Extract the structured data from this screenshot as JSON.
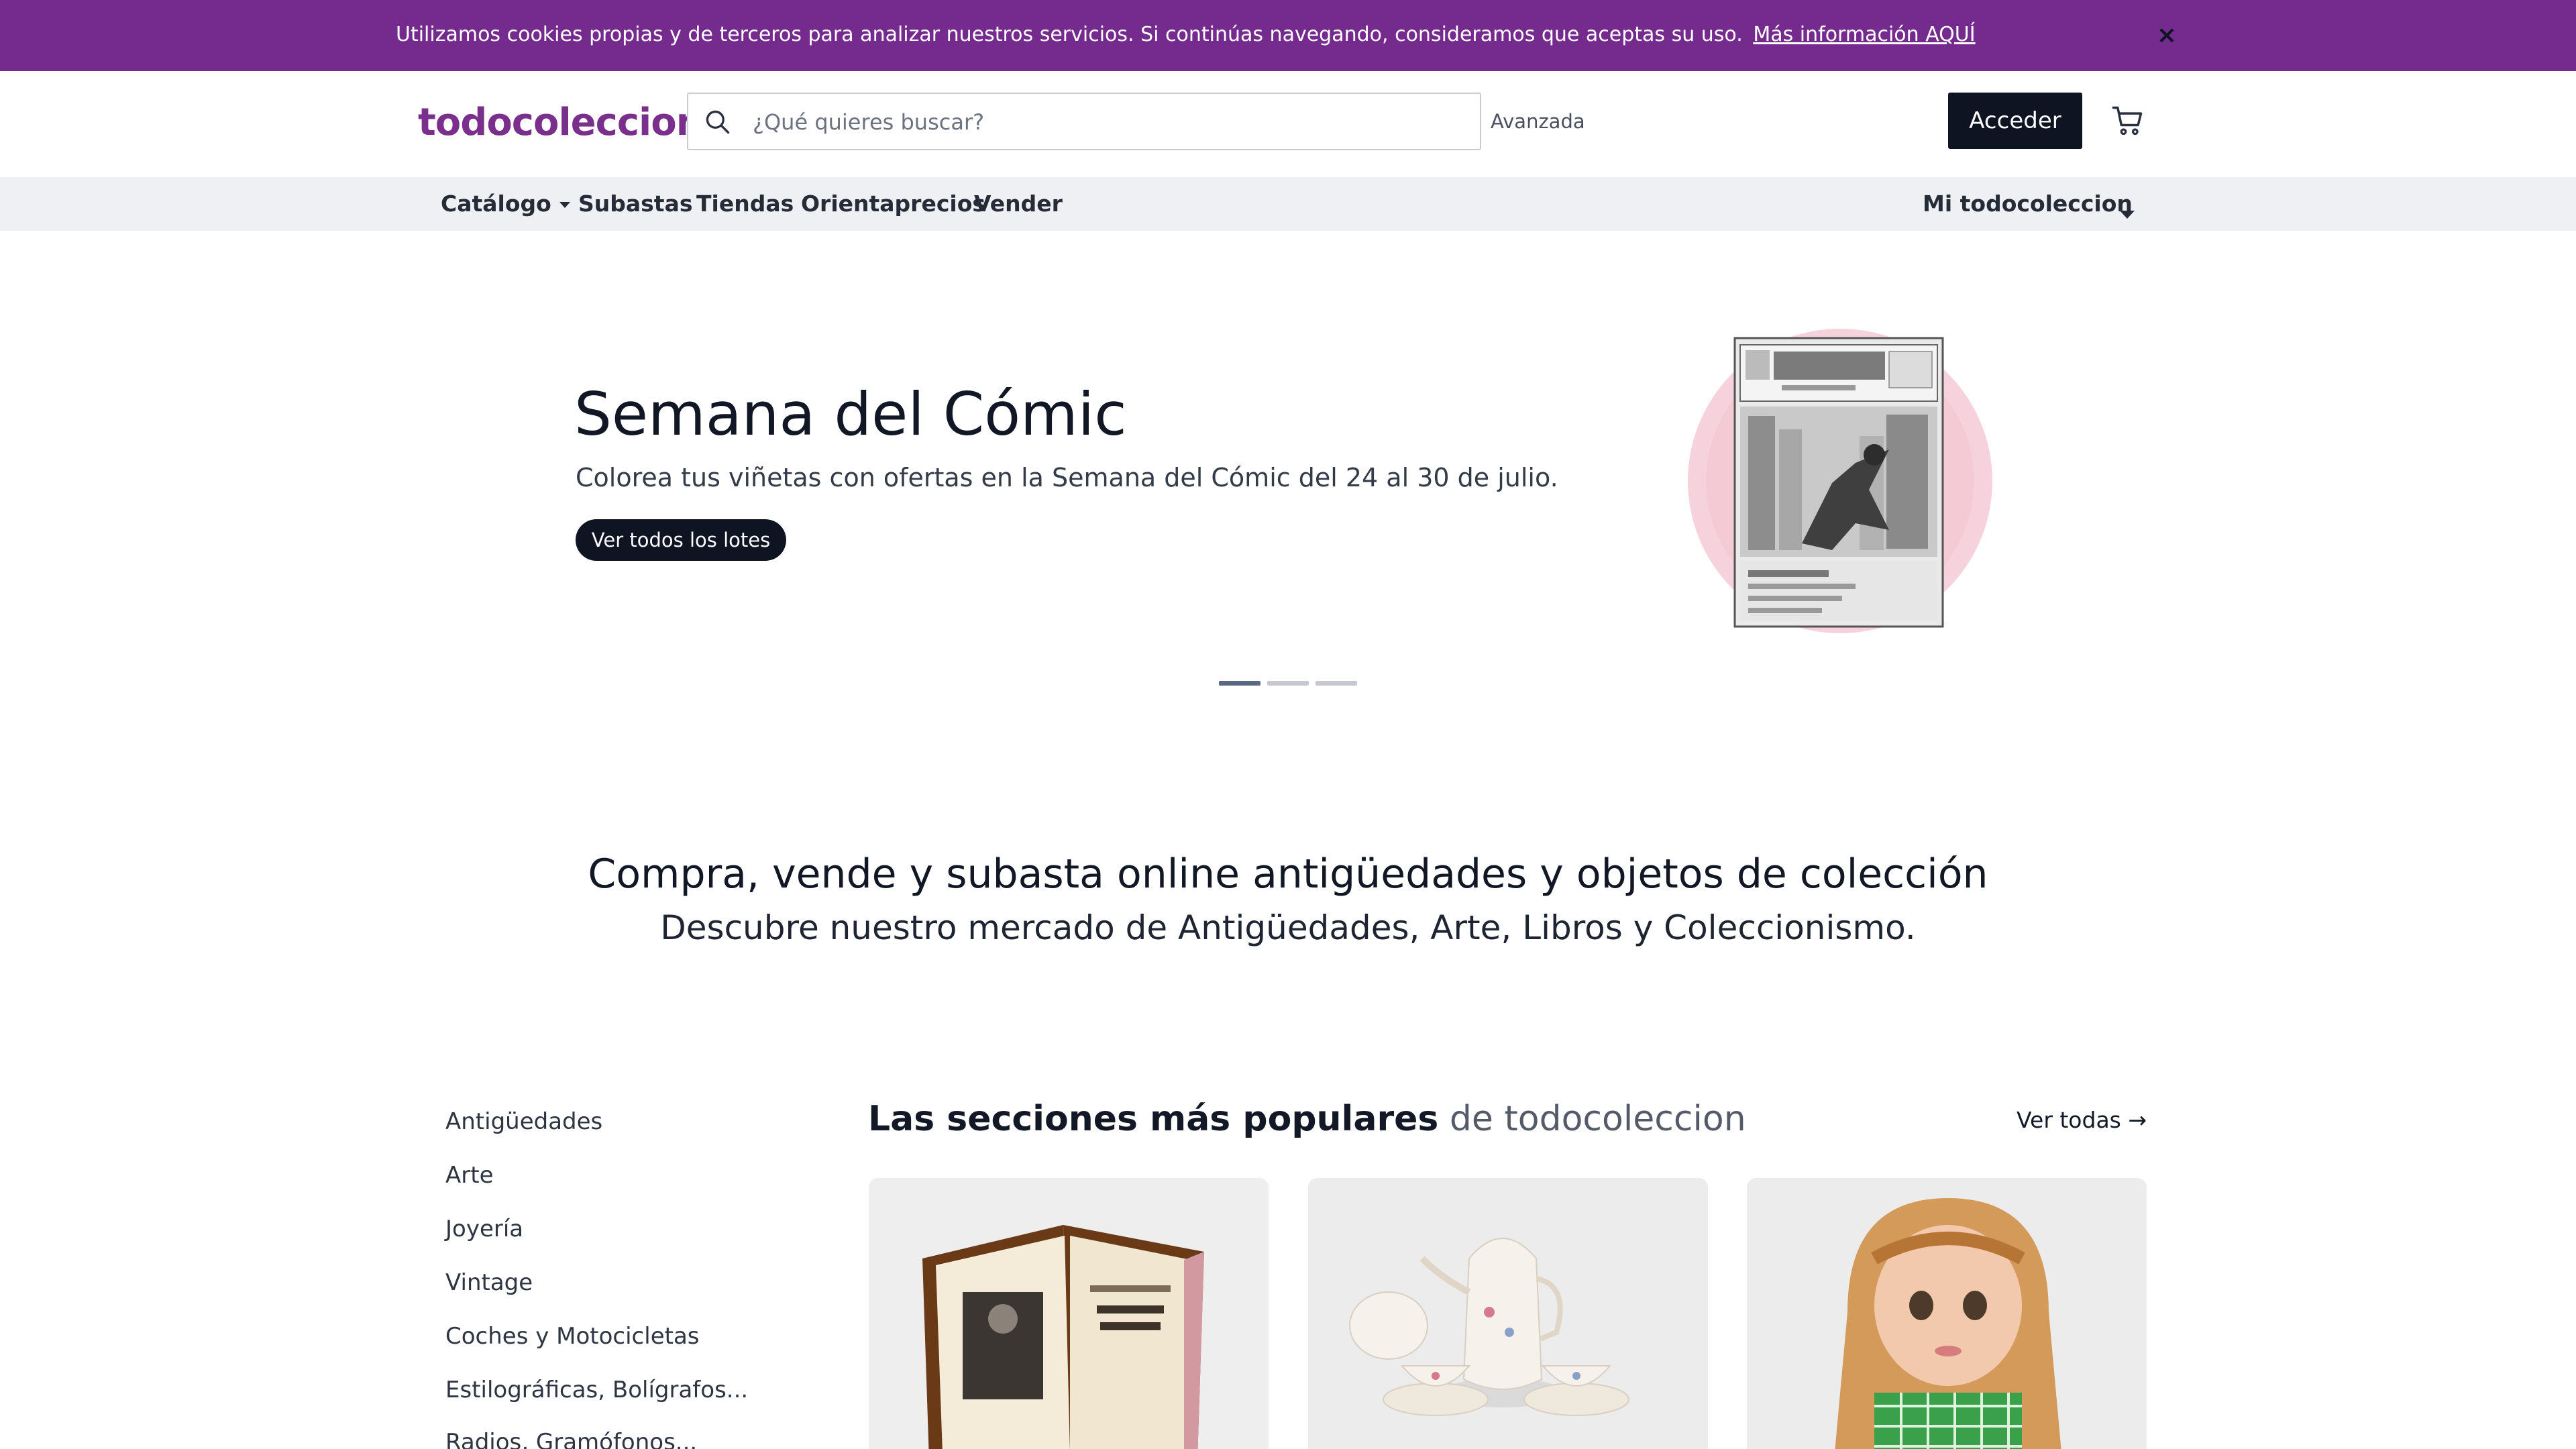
{
  "cookie_bar": {
    "text": "Utilizamos cookies propias y de terceros para analizar nuestros servicios. Si continúas navegando, consideramos que aceptas su uso.",
    "link_label": "Más información AQUÍ",
    "close_label": "×"
  },
  "header": {
    "logo_text": "todocoleccion",
    "search_placeholder": "¿Qué quieres buscar?",
    "advanced_label": "Avanzada",
    "login_label": "Acceder"
  },
  "nav": {
    "items": [
      {
        "label": "Catálogo"
      },
      {
        "label": "Subastas"
      },
      {
        "label": "Tiendas"
      },
      {
        "label": "Orientaprecios"
      },
      {
        "label": "Vender"
      }
    ],
    "account_label": "Mi todocoleccion"
  },
  "hero": {
    "title": "Semana del Cómic",
    "subtitle": "Colorea tus viñetas con ofertas en la Semana del Cómic del 24 al 30 de julio.",
    "button_label": "Ver todos los lotes",
    "image_subject": "Spiderman comic cover",
    "active_slide": 1,
    "slide_count": 3
  },
  "tagline": {
    "title": "Compra, vende y subasta online antigüedades y objetos de colección",
    "subtitle": "Descubre nuestro mercado de Antigüedades, Arte, Libros y Coleccionismo."
  },
  "categories": [
    "Antigüedades",
    "Arte",
    "Joyería",
    "Vintage",
    "Coches y Motocicletas",
    "Estilográficas, Bolígrafos...",
    "Radios, Gramófonos..."
  ],
  "popular": {
    "title_strong": "Las secciones más populares",
    "title_light": "de todocoleccion",
    "see_all_label": "Ver todas →",
    "cards": [
      {
        "subject": "antique book"
      },
      {
        "subject": "porcelain tea set"
      },
      {
        "subject": "vintage doll"
      }
    ]
  },
  "colors": {
    "cookie_bar": "#752a8e",
    "brand": "#7a2f8c",
    "dark": "#0e1422",
    "nav_bg": "#eef0f3"
  }
}
